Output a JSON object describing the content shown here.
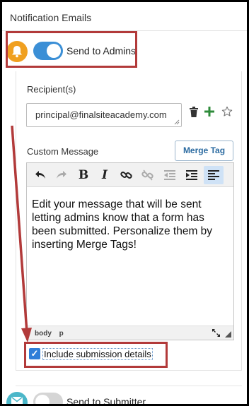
{
  "section_title": "Notification Emails",
  "admins": {
    "toggle_on": true,
    "label": "Send to Admins"
  },
  "recipients": {
    "label": "Recipient(s)",
    "value": "principal@finalsiteacademy.com"
  },
  "custom_message": {
    "label": "Custom Message",
    "merge_tag_button": "Merge Tag",
    "body": "Edit your message that will be sent letting admins know that a form has been submitted. Personalize them by inserting Merge Tags!",
    "toolbar": {
      "bold": "B",
      "italic": "I"
    },
    "path": [
      "body",
      "p"
    ]
  },
  "include_details": {
    "checked": true,
    "label": "Include submission details"
  },
  "submitter": {
    "toggle_on": false,
    "label": "Send to Submitter"
  },
  "colors": {
    "toggle_on": "#3b8fd6",
    "annotation_red": "#b23a3a",
    "bell": "#f0a020",
    "mail": "#4bb7c9",
    "add_green": "#2e8b3a",
    "merge_link": "#2a6aa0"
  },
  "icons": [
    "bell-icon",
    "trash-icon",
    "plus-icon",
    "star-icon",
    "undo-icon",
    "redo-icon",
    "link-icon",
    "unlink-icon",
    "outdent-icon",
    "indent-icon",
    "align-left-icon",
    "fullscreen-icon",
    "mail-icon"
  ]
}
